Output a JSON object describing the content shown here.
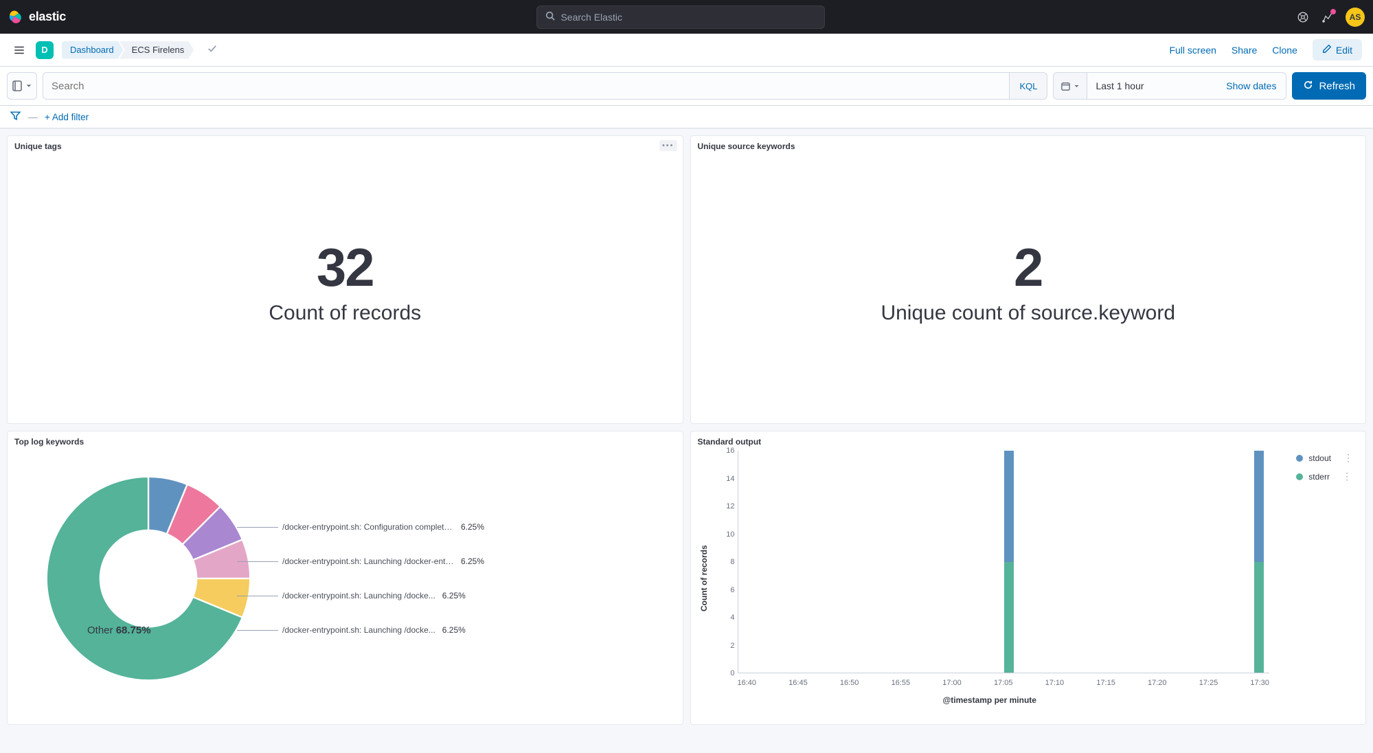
{
  "header": {
    "brand": "elastic",
    "search_placeholder": "Search Elastic",
    "avatar_initials": "AS"
  },
  "breadcrumbs": {
    "app_badge": "D",
    "items": [
      "Dashboard",
      "ECS Firelens"
    ],
    "actions": {
      "fullscreen": "Full screen",
      "share": "Share",
      "clone": "Clone",
      "edit": "Edit"
    }
  },
  "query_bar": {
    "search_placeholder": "Search",
    "language": "KQL",
    "time_label": "Last 1 hour",
    "show_dates": "Show dates",
    "refresh": "Refresh"
  },
  "filter_bar": {
    "add_filter": "+ Add filter"
  },
  "panels": {
    "unique_tags": {
      "title": "Unique tags",
      "value": "32",
      "label": "Count of records"
    },
    "unique_source": {
      "title": "Unique source keywords",
      "value": "2",
      "label": "Unique count of source.keyword"
    },
    "top_log_keywords": {
      "title": "Top log keywords",
      "other_label": "Other",
      "other_pct": "68.75%",
      "slices": [
        {
          "label": "/docker-entrypoint.sh: Configuration complete; ready for s...",
          "pct": "6.25%"
        },
        {
          "label": "/docker-entrypoint.sh: Launching /docker-entr...",
          "pct": "6.25%"
        },
        {
          "label": "/docker-entrypoint.sh: Launching /docke...",
          "pct": "6.25%"
        },
        {
          "label": "/docker-entrypoint.sh: Launching /docke...",
          "pct": "6.25%"
        }
      ]
    },
    "standard_output": {
      "title": "Standard output",
      "y_title": "Count of records",
      "x_title": "@timestamp per minute",
      "legend": [
        "stdout",
        "stderr"
      ]
    }
  },
  "chart_data": [
    {
      "id": "top_log_keywords",
      "type": "pie",
      "title": "Top log keywords",
      "series": [
        {
          "name": "/docker-entrypoint.sh: Configuration complete; ready for start up",
          "value": 6.25,
          "color": "#6092c0"
        },
        {
          "name": "/docker-entrypoint.sh: Launching /docker-entrypoint...",
          "value": 6.25,
          "color": "#ee789d"
        },
        {
          "name": "/docker-entrypoint.sh: Launching /docker...",
          "value": 6.25,
          "color": "#a987d1"
        },
        {
          "name": "/docker-entrypoint.sh: Launching /docker...",
          "value": 6.25,
          "color": "#e4a6c7"
        },
        {
          "name": "/docker-entrypoint.sh: Launching /docker...",
          "value": 6.25,
          "color": "#f5cc5d"
        },
        {
          "name": "Other",
          "value": 68.75,
          "color": "#54b399"
        }
      ]
    },
    {
      "id": "standard_output",
      "type": "bar",
      "title": "Standard output",
      "xlabel": "@timestamp per minute",
      "ylabel": "Count of records",
      "ylim": [
        0,
        16
      ],
      "x_ticks": [
        "16:40",
        "16:45",
        "16:50",
        "16:55",
        "17:00",
        "17:05",
        "17:10",
        "17:15",
        "17:20",
        "17:25",
        "17:30"
      ],
      "series": [
        {
          "name": "stdout",
          "color": "#6092c0",
          "points": [
            {
              "x": "17:07",
              "y": 8
            },
            {
              "x": "17:32",
              "y": 8
            }
          ]
        },
        {
          "name": "stderr",
          "color": "#54b399",
          "points": [
            {
              "x": "17:07",
              "y": 8
            },
            {
              "x": "17:32",
              "y": 8
            }
          ]
        }
      ],
      "stacked_totals": [
        {
          "x": "17:07",
          "total": 16
        },
        {
          "x": "17:32",
          "total": 16
        }
      ]
    }
  ],
  "colors": {
    "primary": "#006bb4",
    "teal": "#54b399",
    "blue": "#6092c0",
    "pink": "#ee789d",
    "purple": "#a987d1",
    "lilac": "#e4a6c7",
    "yellow": "#f5cc5d"
  }
}
